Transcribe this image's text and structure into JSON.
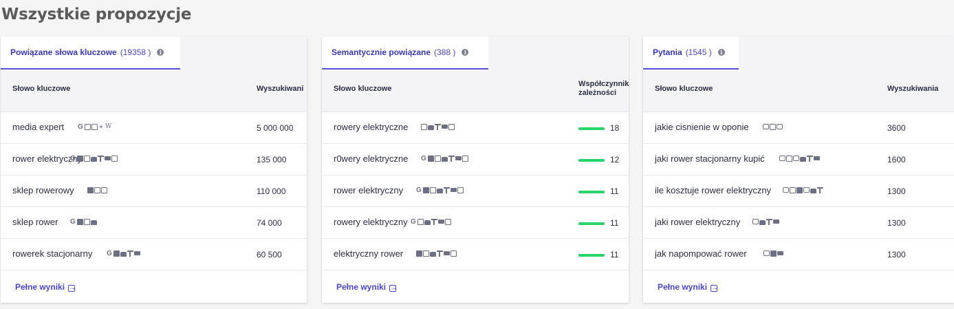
{
  "page_title": "Wszystkie propozycje",
  "panels": [
    {
      "tab_label": "Powiązane słowa kluczowe",
      "tab_count": "(19358 )",
      "col1": "Słowo kluczowe",
      "col2": "Wyszukiwani",
      "more_label": "Pełne wyniki",
      "rows": [
        {
          "keyword": "media expert",
          "value": "5 000 000",
          "features": [
            "google-icon",
            "map-icon",
            "screen-icon",
            "link-icon",
            "wikipedia-icon"
          ]
        },
        {
          "keyword": "rower elektryczny",
          "value": "135 000",
          "features": [
            "google-icon",
            "image-icon",
            "map-icon",
            "bag-icon",
            "tree-icon",
            "camera-icon",
            "book-icon"
          ]
        },
        {
          "keyword": "sklep rowerowy",
          "value": "110 000",
          "features": [
            "image-icon",
            "map-icon",
            "book-icon"
          ]
        },
        {
          "keyword": "sklep rower",
          "value": "74 000",
          "features": [
            "google-icon",
            "image-icon",
            "map-icon",
            "bag-icon"
          ]
        },
        {
          "keyword": "rowerek stacjonarny",
          "value": "60 500",
          "features": [
            "google-icon",
            "image-icon",
            "bag-icon",
            "tree-icon",
            "camera-icon"
          ]
        }
      ]
    },
    {
      "tab_label": "Semantycznie powiązane",
      "tab_count": "(388 )",
      "col1": "Słowo kluczowe",
      "col2": "Współczynnik zależności",
      "more_label": "Pełne wyniki",
      "rows": [
        {
          "keyword": "rowery elektryczne",
          "value": "18",
          "features": [
            "map-icon",
            "bag-icon",
            "tree-icon",
            "camera-icon",
            "book-icon"
          ]
        },
        {
          "keyword": "r0wery elektryczne",
          "value": "12",
          "features": [
            "google-icon",
            "image-icon",
            "map-icon",
            "bag-icon",
            "tree-icon",
            "camera-icon",
            "book-icon"
          ]
        },
        {
          "keyword": "rower elektryczny",
          "value": "11",
          "features": [
            "google-icon",
            "image-icon",
            "map-icon",
            "bag-icon",
            "tree-icon",
            "camera-icon",
            "book-icon"
          ]
        },
        {
          "keyword": "rowery elektryczny",
          "value": "11",
          "features": [
            "google-icon",
            "map-icon",
            "bag-icon",
            "tree-icon",
            "camera-icon",
            "book-icon"
          ]
        },
        {
          "keyword": "elektryczny rower",
          "value": "11",
          "features": [
            "image-icon",
            "map-icon",
            "bag-icon",
            "tree-icon",
            "camera-icon",
            "book-icon"
          ]
        }
      ]
    },
    {
      "tab_label": "Pytania",
      "tab_count": "(1545 )",
      "col1": "Słowo kluczowe",
      "col2": "Wyszukiwania",
      "more_label": "Pełne wyniki",
      "rows": [
        {
          "keyword": "jakie cisnienie w oponie",
          "value": "3600",
          "features": [
            "question-icon",
            "screen-icon",
            "bubble-icon"
          ]
        },
        {
          "keyword": "jaki rower stacjonarny kupić",
          "value": "1600",
          "features": [
            "question-icon",
            "screen-icon",
            "bubble-icon",
            "bag-icon",
            "tree-icon",
            "camera-icon"
          ]
        },
        {
          "keyword": "ile kosztuje rower elektryczny",
          "value": "1300",
          "features": [
            "question-icon",
            "screen-icon",
            "image-icon",
            "bubble-icon",
            "bag-icon",
            "tree-icon"
          ]
        },
        {
          "keyword": "jaki rower elektryczny",
          "value": "1300",
          "features": [
            "question-icon",
            "bag-icon",
            "tree-icon",
            "camera-icon"
          ]
        },
        {
          "keyword": "jak napompować rower",
          "value": "1300",
          "features": [
            "question-icon",
            "image-icon",
            "camera-icon"
          ]
        }
      ]
    }
  ],
  "colors": {
    "accent": "#5b4fd8",
    "link": "#4a45c8",
    "bar": "#2ad46b",
    "background": "#f5f5f6"
  }
}
